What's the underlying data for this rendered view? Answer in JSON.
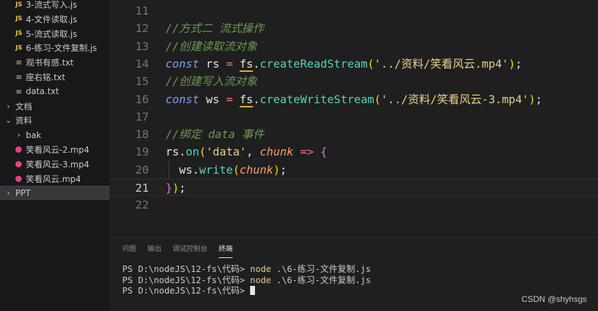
{
  "explorer": {
    "items": [
      {
        "type": "js",
        "icon": "js-icon",
        "icon_text": "JS",
        "label": "3-流式写入.js"
      },
      {
        "type": "js",
        "icon": "js-icon",
        "icon_text": "JS",
        "label": "4-文件读取.js"
      },
      {
        "type": "js",
        "icon": "js-icon",
        "icon_text": "JS",
        "label": "5-流式读取.js"
      },
      {
        "type": "js",
        "icon": "js-icon",
        "icon_text": "JS",
        "label": "6-练习-文件复制.js"
      },
      {
        "type": "txt",
        "icon": "text-file-icon",
        "icon_text": "≡",
        "label": "观书有感.txt"
      },
      {
        "type": "txt",
        "icon": "text-file-icon",
        "icon_text": "≡",
        "label": "座右铭.txt"
      },
      {
        "type": "txt",
        "icon": "text-file-icon",
        "icon_text": "≡",
        "label": "data.txt"
      },
      {
        "type": "folder",
        "icon": "chevron-right-icon",
        "icon_text": "›",
        "label": "文档"
      },
      {
        "type": "folder",
        "icon": "chevron-down-icon",
        "icon_text": "⌄",
        "label": "资料"
      },
      {
        "type": "folder",
        "icon": "chevron-right-icon",
        "icon_text": "›",
        "label": "bak"
      },
      {
        "type": "mp4",
        "icon": "video-file-icon",
        "icon_text": "",
        "label": "笑看风云-2.mp4"
      },
      {
        "type": "mp4",
        "icon": "video-file-icon",
        "icon_text": "",
        "label": "笑看风云-3.mp4"
      },
      {
        "type": "mp4",
        "icon": "video-file-icon",
        "icon_text": "",
        "label": "笑看风云.mp4"
      },
      {
        "type": "folder",
        "icon": "chevron-right-icon",
        "icon_text": "›",
        "label": "PPT"
      }
    ]
  },
  "editor": {
    "lines": [
      {
        "number": "11",
        "tokens": []
      },
      {
        "number": "12",
        "tokens": [
          {
            "c": "cmt",
            "t": "//方式二 流式操作"
          }
        ]
      },
      {
        "number": "13",
        "tokens": [
          {
            "c": "cmt",
            "t": "//创建读取流对象"
          }
        ]
      },
      {
        "number": "14",
        "tokens": [
          {
            "c": "kw",
            "t": "const"
          },
          {
            "c": "var",
            "t": " rs "
          },
          {
            "c": "op",
            "t": "="
          },
          {
            "c": "var",
            "t": " "
          },
          {
            "c": "obj",
            "t": "fs"
          },
          {
            "c": "punc",
            "t": "."
          },
          {
            "c": "fn",
            "t": "createReadStream"
          },
          {
            "c": "paren",
            "t": "("
          },
          {
            "c": "str",
            "t": "'../资料/笑看风云.mp4'"
          },
          {
            "c": "paren",
            "t": ")"
          },
          {
            "c": "punc",
            "t": ";"
          }
        ]
      },
      {
        "number": "15",
        "tokens": [
          {
            "c": "cmt",
            "t": "//创建写入流对象"
          }
        ]
      },
      {
        "number": "16",
        "tokens": [
          {
            "c": "kw",
            "t": "const"
          },
          {
            "c": "var",
            "t": " ws "
          },
          {
            "c": "op",
            "t": "="
          },
          {
            "c": "var",
            "t": " "
          },
          {
            "c": "obj",
            "t": "fs"
          },
          {
            "c": "punc",
            "t": "."
          },
          {
            "c": "fn",
            "t": "createWriteStream"
          },
          {
            "c": "paren",
            "t": "("
          },
          {
            "c": "str",
            "t": "'../资料/笑看风云-3.mp4'"
          },
          {
            "c": "paren",
            "t": ")"
          },
          {
            "c": "punc",
            "t": ";"
          }
        ]
      },
      {
        "number": "17",
        "tokens": []
      },
      {
        "number": "18",
        "tokens": [
          {
            "c": "cmt",
            "t": "//绑定 data 事件"
          }
        ]
      },
      {
        "number": "19",
        "tokens": [
          {
            "c": "var",
            "t": "rs"
          },
          {
            "c": "punc",
            "t": "."
          },
          {
            "c": "fn",
            "t": "on"
          },
          {
            "c": "paren",
            "t": "("
          },
          {
            "c": "str",
            "t": "'data'"
          },
          {
            "c": "punc",
            "t": ", "
          },
          {
            "c": "param",
            "t": "chunk"
          },
          {
            "c": "punc",
            "t": " "
          },
          {
            "c": "op",
            "t": "=>"
          },
          {
            "c": "punc",
            "t": " "
          },
          {
            "c": "paren2",
            "t": "{"
          }
        ]
      },
      {
        "number": "20",
        "tokens": [
          {
            "c": "var",
            "t": "  ws"
          },
          {
            "c": "punc",
            "t": "."
          },
          {
            "c": "fn",
            "t": "write"
          },
          {
            "c": "paren",
            "t": "("
          },
          {
            "c": "param",
            "t": "chunk"
          },
          {
            "c": "paren",
            "t": ")"
          },
          {
            "c": "punc",
            "t": ";"
          }
        ]
      },
      {
        "number": "21",
        "active": true,
        "tokens": [
          {
            "c": "paren2",
            "t": "}"
          },
          {
            "c": "paren",
            "t": ")"
          },
          {
            "c": "punc",
            "t": ";"
          }
        ]
      },
      {
        "number": "22",
        "tokens": []
      }
    ]
  },
  "panel": {
    "tabs": [
      "问题",
      "输出",
      "调试控制台",
      "终端"
    ],
    "active_tab": "终端",
    "terminal": [
      {
        "prompt": "PS D:\\nodeJS\\12-fs\\代码> ",
        "cmd": "node",
        "args": " .\\6-练习-文件复制.js"
      },
      {
        "prompt": "PS D:\\nodeJS\\12-fs\\代码> ",
        "cmd": "node",
        "args": " .\\6-练习-文件复制.js"
      },
      {
        "prompt": "PS D:\\nodeJS\\12-fs\\代码> ",
        "cmd": "",
        "args": ""
      }
    ]
  },
  "watermark": "CSDN @shyhsgs"
}
